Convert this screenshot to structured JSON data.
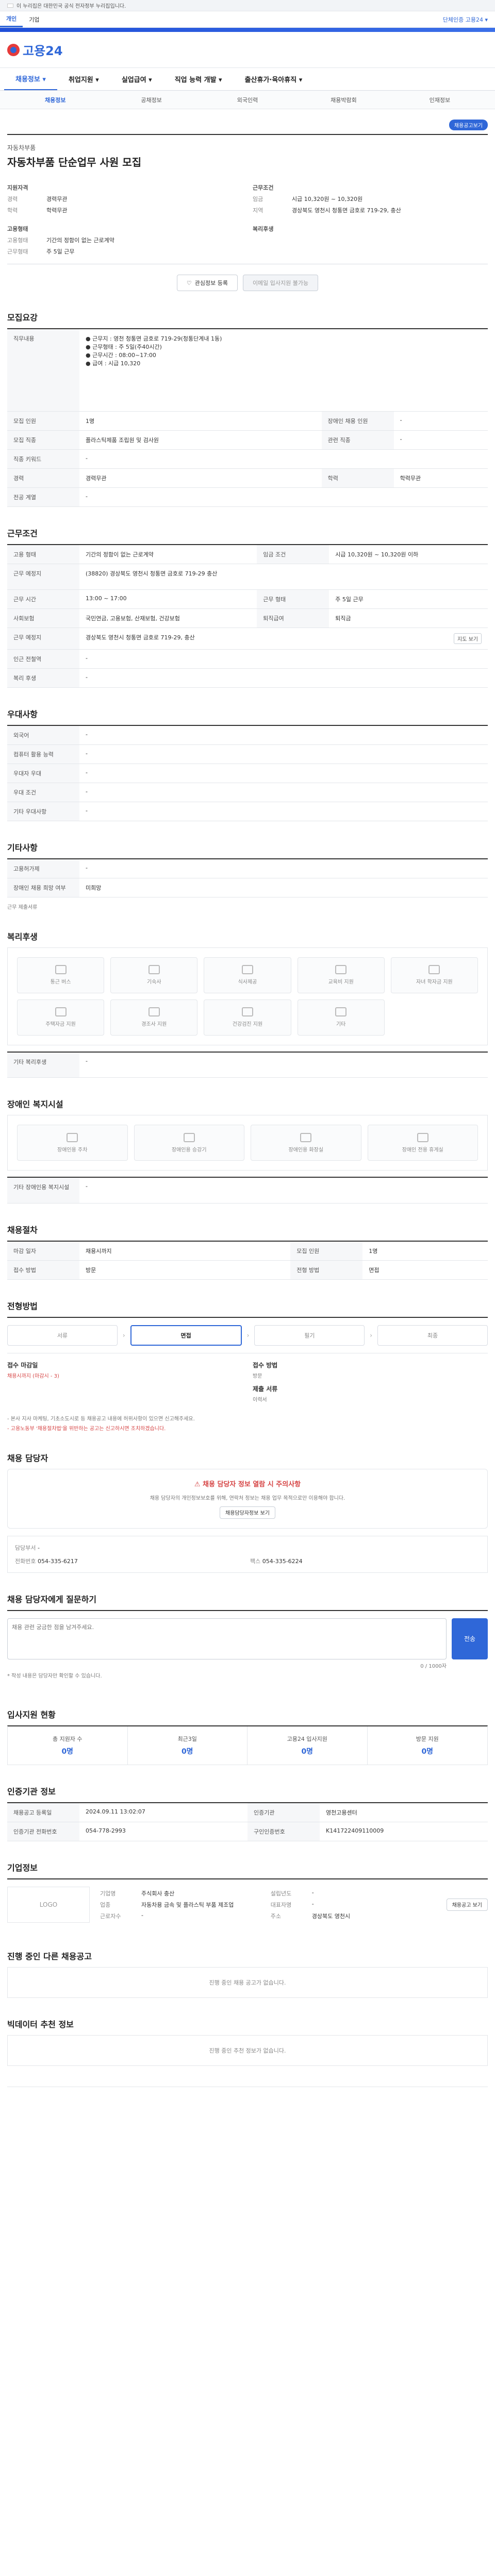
{
  "topbar": {
    "text": "이 누리집은 대한민국 공식 전자정부 누리집입니다."
  },
  "gnb": {
    "tabs": [
      "개인",
      "기업"
    ],
    "right": "단체인증 고용24 ▾"
  },
  "header": {
    "logo": "고용24"
  },
  "main_menu": [
    "채용정보 ▾",
    "취업지원 ▾",
    "실업급여 ▾",
    "직업 능력 개발 ▾",
    "출산휴가·육아휴직 ▾"
  ],
  "sub_menu": [
    "채용정보",
    "공채정보",
    "외국인력",
    "채용박람회",
    "인재정보"
  ],
  "summary": {
    "badge": "채용공고보기",
    "company": "자동차부품",
    "title": "자동차부품 단순업무 사원 모집",
    "left_group": "지원자격",
    "left_rows": [
      [
        "경력",
        "경력무관"
      ],
      [
        "학력",
        "학력무관"
      ]
    ],
    "right_group": "근무조건",
    "right_rows": [
      [
        "임금",
        "시급 10,320원 ~ 10,320원"
      ],
      [
        "지역",
        "경상북도 영천시 청통면 금호로 719-29, 충산"
      ]
    ],
    "left_group2": "고용형태",
    "left_rows2": [
      [
        "고용형태",
        "기간의 정함이 없는 근로계약"
      ],
      [
        "근무형태",
        "주 5일 근무"
      ]
    ],
    "right_group2": "복리후생",
    "right_rows2": [
      [
        "",
        ""
      ]
    ]
  },
  "actions": {
    "bookmark": "관심정보 등록",
    "apply": "이메일 입사지원 불가능"
  },
  "sections": {
    "recruit": "모집요강",
    "work": "근무조건",
    "pref": "우대사항",
    "etc": "기타사항",
    "welfare": "복리후생",
    "disabled": "장애인 복지시설",
    "process": "채용절차",
    "process_step": "전형방법",
    "manager": "채용 담당자",
    "comment": "채용 담당자에게 질문하기",
    "applicants": "입사지원 현황",
    "info": "인증기관 정보",
    "corp": "기업정보",
    "similar": "진행 중인 다른 채용공고",
    "recommend": "빅데이터 추천 정보"
  },
  "recruit_table": [
    [
      "직무내용",
      "● 근무지 : 영천 청통면 금호로 719-29(청통단계내 1동)\n● 근무형태 : 주 5일(주40시간)\n● 근무시간 : 08:00~17:00\n● 급여 : 시급 10,320"
    ],
    [
      "모집 인원",
      "1명",
      "장애인 채용 인원",
      "-"
    ],
    [
      "모집 직종",
      "플라스틱제품 조립원 및 검사원",
      "관련 직종",
      "-"
    ],
    [
      "직종 키워드",
      "-"
    ],
    [
      "경력",
      "경력무관",
      "학력",
      "학력무관"
    ],
    [
      "전공 계열",
      "-"
    ]
  ],
  "work_table": [
    [
      "고용 형태",
      "기간의 정함이 없는 근로계약",
      "임금 조건",
      "시급 10,320원 ~ 10,320원 이하"
    ],
    [
      "근무 예정지",
      "(38820) 경상북도 영천시 청통면 금호로 719-29 충산"
    ],
    [
      "근무 시간",
      "13:00 ~ 17:00",
      "근무 형태",
      "주 5일 근무"
    ],
    [
      "사회보험",
      "국민연금, 고용보험, 산재보험, 건강보험",
      "퇴직급여",
      "퇴직금"
    ],
    [
      "근무 예정지",
      "경상북도 영천시 청통면 금호로 719-29, 충산"
    ],
    [
      "인근 전철역",
      "-"
    ],
    [
      "복리 후생",
      "-"
    ]
  ],
  "pref_table": [
    [
      "외국어",
      "-"
    ],
    [
      "컴퓨터 활용 능력",
      "-"
    ],
    [
      "우대자 우대",
      "-"
    ],
    [
      "우대 조건",
      "-"
    ],
    [
      "기타 우대사항",
      "-"
    ]
  ],
  "etc_table": [
    [
      "고용허가제",
      "-"
    ],
    [
      "장애인 채용 희망 여부",
      "미희망"
    ]
  ],
  "etc_note": "근무 제출서류",
  "welfare_icons": [
    "통근 버스",
    "기숙사",
    "식사제공",
    "교육비 지원",
    "자녀 학자금 지원",
    "주택자금 지원",
    "경조사 지원",
    "건강검진 지원",
    "기타"
  ],
  "welfare_etc": "기타 복리후생",
  "disabled_icons": [
    "장애인용 주차",
    "장애인용 승강기",
    "장애인용 화장실",
    "장애인 전용 휴게실"
  ],
  "disabled_etc": "기타 장애인용 복지시설",
  "process_rows": [
    [
      "마감 일자",
      "채용시까지"
    ],
    [
      "모집 인원",
      "1명"
    ],
    [
      "접수 방법",
      "방문"
    ],
    [
      "전형 방법",
      "면접"
    ]
  ],
  "steps": [
    "서류",
    "면접",
    "필기",
    "최종"
  ],
  "process_detail": {
    "left_title": "접수 마감일",
    "left_val": "채용시까지 (마감시 - 3)",
    "right_title": "접수 방법",
    "right_val": "방문",
    "extra_title": "제출 서류",
    "extra_val": "이력서"
  },
  "process_notes": [
    "- 본사 지사 마케팅, 기초소도시로 등 채용공고 내용에 허위사항이 있으면 신고해주세요.",
    "- 고용노동부 '채용절차법'을 위반하는 공고는 신고하시면 조치하겠습니다."
  ],
  "manager": {
    "warn": "채용 담당자 정보 열람 시 주의사항",
    "desc": "채용 담당자의 개인정보보호를 위해, 연락처 정보는 채용 업무 목적으로만 이용해야 합니다.",
    "btn": "채용담당자정보 보기",
    "contact_rows": [
      [
        "담당부서",
        "-"
      ],
      [
        "전화번호",
        "054-335-6217"
      ],
      [
        "팩스",
        "054-335-6224"
      ]
    ]
  },
  "comment": {
    "placeholder": "채용 관련 궁금한 점을 남겨주세요.",
    "counter": "0 / 1000자",
    "submit": "전송",
    "note": "* 작성 내용은 담당자만 확인할 수 있습니다."
  },
  "applicants": [
    {
      "label": "총 지원자 수",
      "val": "0명"
    },
    {
      "label": "최근3일",
      "val": "0명"
    },
    {
      "label": "고용24 입사지원",
      "val": "0명"
    },
    {
      "label": "방문 지원",
      "val": "0명"
    }
  ],
  "info_rows": [
    [
      "채용공고 등록일",
      "2024.09.11 13:02:07",
      "인증기관",
      "영천고용센터"
    ],
    [
      "인증기관 전화번호",
      "054-778-2993",
      "구인인증번호",
      "K141722409110009"
    ]
  ],
  "corp": {
    "logo": "LOGO",
    "rows": [
      [
        "기업명",
        "주식회사 충산"
      ],
      [
        "업종",
        "자동차용 금속 및 플라스틱 부품 제조업"
      ],
      [
        "설립년도",
        "-"
      ],
      [
        "대표자명",
        "-"
      ],
      [
        "근로자수",
        "-"
      ],
      [
        "주소",
        "경상북도 영천시"
      ]
    ],
    "btn": "채용공고 보기"
  },
  "similar_empty": "진행 중인 채용 공고가 없습니다.",
  "recommend_empty": "진행 중인 추천 정보가 없습니다."
}
